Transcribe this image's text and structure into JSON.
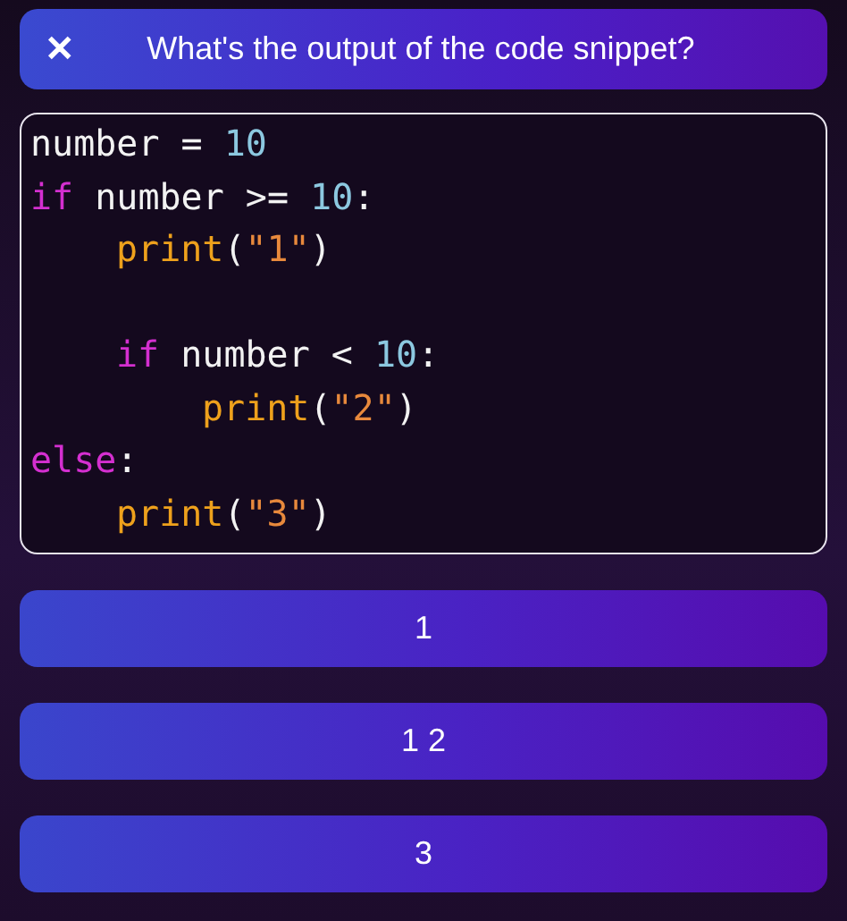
{
  "header": {
    "close_icon": "✕",
    "title": "What's the output of the code snippet?"
  },
  "code": {
    "lines": [
      {
        "kind": "code",
        "tokens": [
          {
            "kind": "plain",
            "text": "number = "
          },
          {
            "kind": "number",
            "text": "10"
          }
        ]
      },
      {
        "kind": "code",
        "tokens": [
          {
            "kind": "keyword",
            "text": "if"
          },
          {
            "kind": "plain",
            "text": " number >= "
          },
          {
            "kind": "number",
            "text": "10"
          },
          {
            "kind": "plain",
            "text": ":"
          }
        ],
        "children": [
          {
            "kind": "code",
            "tokens": [
              {
                "kind": "func",
                "text": "print"
              },
              {
                "kind": "plain",
                "text": "("
              },
              {
                "kind": "string",
                "text": "\"1\""
              },
              {
                "kind": "plain",
                "text": ")"
              }
            ]
          },
          {
            "kind": "blank"
          },
          {
            "kind": "code",
            "tokens": [
              {
                "kind": "keyword",
                "text": "if"
              },
              {
                "kind": "plain",
                "text": " number < "
              },
              {
                "kind": "number",
                "text": "10"
              },
              {
                "kind": "plain",
                "text": ":"
              }
            ],
            "children": [
              {
                "kind": "code",
                "tokens": [
                  {
                    "kind": "func",
                    "text": "print"
                  },
                  {
                    "kind": "plain",
                    "text": "("
                  },
                  {
                    "kind": "string",
                    "text": "\"2\""
                  },
                  {
                    "kind": "plain",
                    "text": ")"
                  }
                ]
              }
            ]
          }
        ]
      },
      {
        "kind": "code",
        "tokens": [
          {
            "kind": "keyword",
            "text": "else"
          },
          {
            "kind": "plain",
            "text": ":"
          }
        ],
        "children": [
          {
            "kind": "code",
            "tokens": [
              {
                "kind": "func",
                "text": "print"
              },
              {
                "kind": "plain",
                "text": "("
              },
              {
                "kind": "string",
                "text": "\"3\""
              },
              {
                "kind": "plain",
                "text": ")"
              }
            ]
          }
        ]
      }
    ]
  },
  "answers": [
    {
      "label": "1"
    },
    {
      "label": "1 2"
    },
    {
      "label": "3"
    }
  ]
}
